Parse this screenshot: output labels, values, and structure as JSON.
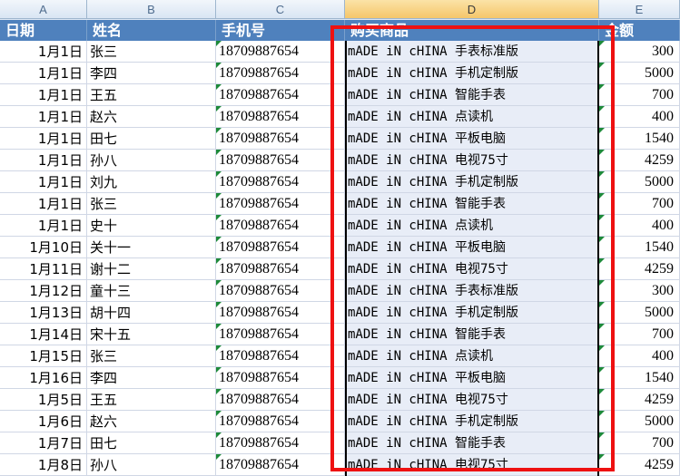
{
  "columns": [
    "A",
    "B",
    "C",
    "D",
    "E"
  ],
  "headers": {
    "date": "日期",
    "name": "姓名",
    "phone": "手机号",
    "product": "购买商品",
    "amount": "金额"
  },
  "rows": [
    {
      "date": "1月1日",
      "name": "张三",
      "phone": "18709887654",
      "product": "mADE iN cHINA 手表标准版",
      "amount": "300"
    },
    {
      "date": "1月1日",
      "name": "李四",
      "phone": "18709887654",
      "product": "mADE iN cHINA 手机定制版",
      "amount": "5000"
    },
    {
      "date": "1月1日",
      "name": "王五",
      "phone": "18709887654",
      "product": "mADE iN cHINA 智能手表",
      "amount": "700"
    },
    {
      "date": "1月1日",
      "name": "赵六",
      "phone": "18709887654",
      "product": "mADE iN cHINA 点读机",
      "amount": "400"
    },
    {
      "date": "1月1日",
      "name": "田七",
      "phone": "18709887654",
      "product": "mADE iN cHINA 平板电脑",
      "amount": "1540"
    },
    {
      "date": "1月1日",
      "name": "孙八",
      "phone": "18709887654",
      "product": "mADE iN cHINA 电视75寸",
      "amount": "4259"
    },
    {
      "date": "1月1日",
      "name": "刘九",
      "phone": "18709887654",
      "product": "mADE iN cHINA 手机定制版",
      "amount": "5000"
    },
    {
      "date": "1月1日",
      "name": "张三",
      "phone": "18709887654",
      "product": "mADE iN cHINA 智能手表",
      "amount": "700"
    },
    {
      "date": "1月1日",
      "name": "史十",
      "phone": "18709887654",
      "product": "mADE iN cHINA 点读机",
      "amount": "400"
    },
    {
      "date": "1月10日",
      "name": "关十一",
      "phone": "18709887654",
      "product": "mADE iN cHINA 平板电脑",
      "amount": "1540"
    },
    {
      "date": "1月11日",
      "name": "谢十二",
      "phone": "18709887654",
      "product": "mADE iN cHINA 电视75寸",
      "amount": "4259"
    },
    {
      "date": "1月12日",
      "name": "童十三",
      "phone": "18709887654",
      "product": "mADE iN cHINA 手表标准版",
      "amount": "300"
    },
    {
      "date": "1月13日",
      "name": "胡十四",
      "phone": "18709887654",
      "product": "mADE iN cHINA 手机定制版",
      "amount": "5000"
    },
    {
      "date": "1月14日",
      "name": "宋十五",
      "phone": "18709887654",
      "product": "mADE iN cHINA 智能手表",
      "amount": "700"
    },
    {
      "date": "1月15日",
      "name": "张三",
      "phone": "18709887654",
      "product": "mADE iN cHINA 点读机",
      "amount": "400"
    },
    {
      "date": "1月16日",
      "name": "李四",
      "phone": "18709887654",
      "product": "mADE iN cHINA 平板电脑",
      "amount": "1540"
    },
    {
      "date": "1月5日",
      "name": "王五",
      "phone": "18709887654",
      "product": "mADE iN cHINA 电视75寸",
      "amount": "4259"
    },
    {
      "date": "1月6日",
      "name": "赵六",
      "phone": "18709887654",
      "product": "mADE iN cHINA 手机定制版",
      "amount": "5000"
    },
    {
      "date": "1月7日",
      "name": "田七",
      "phone": "18709887654",
      "product": "mADE iN cHINA 智能手表",
      "amount": "700"
    },
    {
      "date": "1月8日",
      "name": "孙八",
      "phone": "18709887654",
      "product": "mADE iN cHINA 电视75寸",
      "amount": "4259"
    }
  ],
  "colors": {
    "header_fill": "#4f81bd",
    "annotation_box": "#ee1111",
    "selected_column_fill": "#e8edf7",
    "error_indicator": "#1e8a3a"
  }
}
